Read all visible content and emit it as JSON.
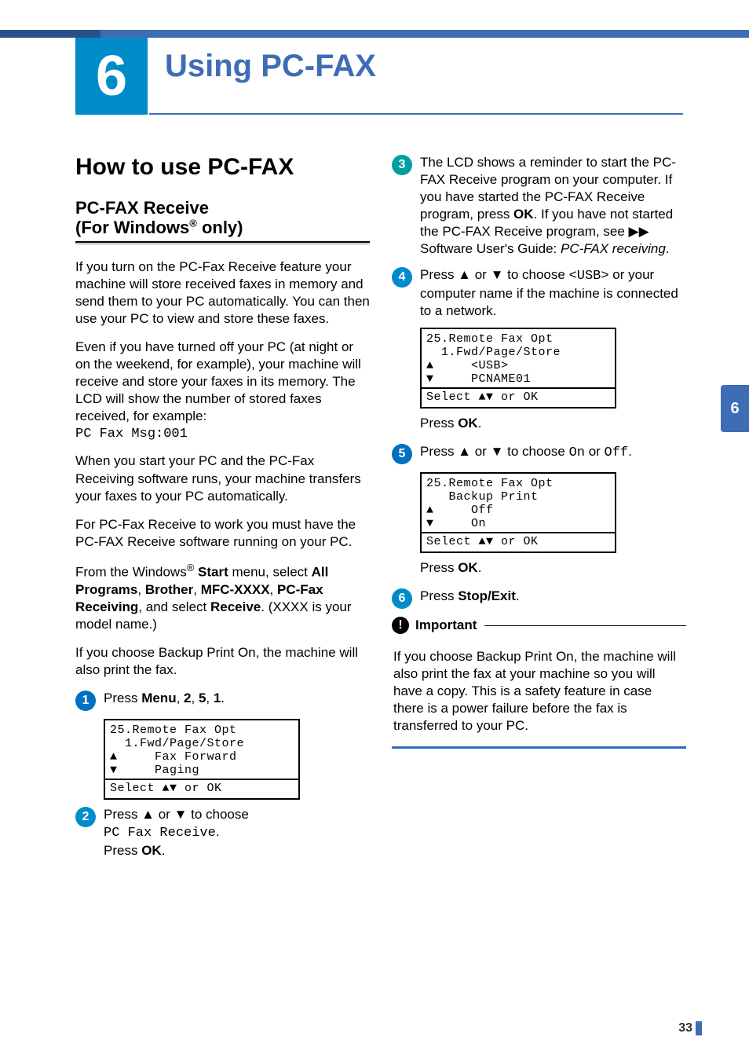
{
  "chapter": {
    "number": "6",
    "title": "Using PC-FAX"
  },
  "section": {
    "title": "How to use PC-FAX"
  },
  "subsection": {
    "line1": "PC-FAX Receive",
    "line2_pre": "(For Windows",
    "line2_sup": "®",
    "line2_post": " only)"
  },
  "left": {
    "para1": "If you turn on the PC-Fax Receive feature your machine will store received faxes in memory and send them to your PC automatically. You can then use your PC to view and store these faxes.",
    "para2": "Even if you have turned off your PC (at night or on the weekend, for example), your machine will receive and store your faxes in its memory. The LCD will show the number of stored faxes received, for example:",
    "mono1": "PC Fax Msg:001",
    "para3": "When you start your PC and the PC-Fax Receiving software runs, your machine transfers your faxes to your PC automatically.",
    "para4": "For PC-Fax Receive to work you must have the PC-FAX Receive software running on your PC.",
    "para5_pre": "From the Windows",
    "para5_sup": "®",
    "para5_b1": " Start",
    "para5_mid1": " menu, select ",
    "para5_b2": "All Programs",
    "para5_mid2": ", ",
    "para5_b3": "Brother",
    "para5_mid3": ", ",
    "para5_b4": "MFC-XXXX",
    "para5_mid4": ", ",
    "para5_b5": "PC-Fax Receiving",
    "para5_mid5": ", and select ",
    "para5_b6": "Receive",
    "para5_end": ". (XXXX is your model name.)",
    "para6": "If you choose Backup Print On, the machine will also print the fax.",
    "step1_pre": "Press ",
    "step1_b1": "Menu",
    "step1_mid1": ", ",
    "step1_b2": "2",
    "step1_mid2": ", ",
    "step1_b3": "5",
    "step1_mid3": ", ",
    "step1_b4": "1",
    "step1_end": ".",
    "lcd1": {
      "l1": "25.Remote Fax Opt",
      "l2": "  1.Fwd/Page/Store",
      "l3": "▲     Fax Forward",
      "l4": "▼     Paging",
      "b": "Select ▲▼ or OK"
    },
    "step2_line1": "Press ▲ or ▼ to choose",
    "step2_mono": "PC Fax Receive",
    "step2_dot": ".",
    "step2_line3_pre": "Press ",
    "step2_line3_b": "OK",
    "step2_line3_end": "."
  },
  "right": {
    "step3_a": "The LCD shows a reminder to start the PC-FAX Receive program on your computer. If you have started the PC-FAX Receive program, press ",
    "step3_b1": "OK",
    "step3_c": ". If you have not started the PC-FAX Receive program, see ▶▶ Software User's Guide: ",
    "step3_i": "PC-FAX receiving",
    "step3_end": ".",
    "step4_pre": "Press ▲ or ▼ to choose ",
    "step4_mono": "<USB>",
    "step4_post": " or your computer name if the machine is connected to a network.",
    "lcd2": {
      "l1": "25.Remote Fax Opt",
      "l2": "  1.Fwd/Page/Store",
      "l3": "▲     <USB>",
      "l4": "▼     PCNAME01",
      "b": "Select ▲▼ or OK"
    },
    "pressok_pre": "Press ",
    "pressok_b": "OK",
    "pressok_end": ".",
    "step5_pre": "Press ▲ or ▼ to choose ",
    "step5_m1": "On",
    "step5_mid": " or ",
    "step5_m2": "Off",
    "step5_end": ".",
    "lcd3": {
      "l1": "25.Remote Fax Opt",
      "l2": "   Backup Print",
      "l3": "▲     Off",
      "l4": "▼     On",
      "b": "Select ▲▼ or OK"
    },
    "step6_pre": "Press ",
    "step6_b": "Stop/Exit",
    "step6_end": ".",
    "important_head": "Important",
    "important_body": "If you choose Backup Print On, the machine will also print the fax at your machine so you will have a copy. This is a safety feature in case there is a power failure before the fax is transferred to your PC."
  },
  "sidetab": "6",
  "pagenum": "33"
}
